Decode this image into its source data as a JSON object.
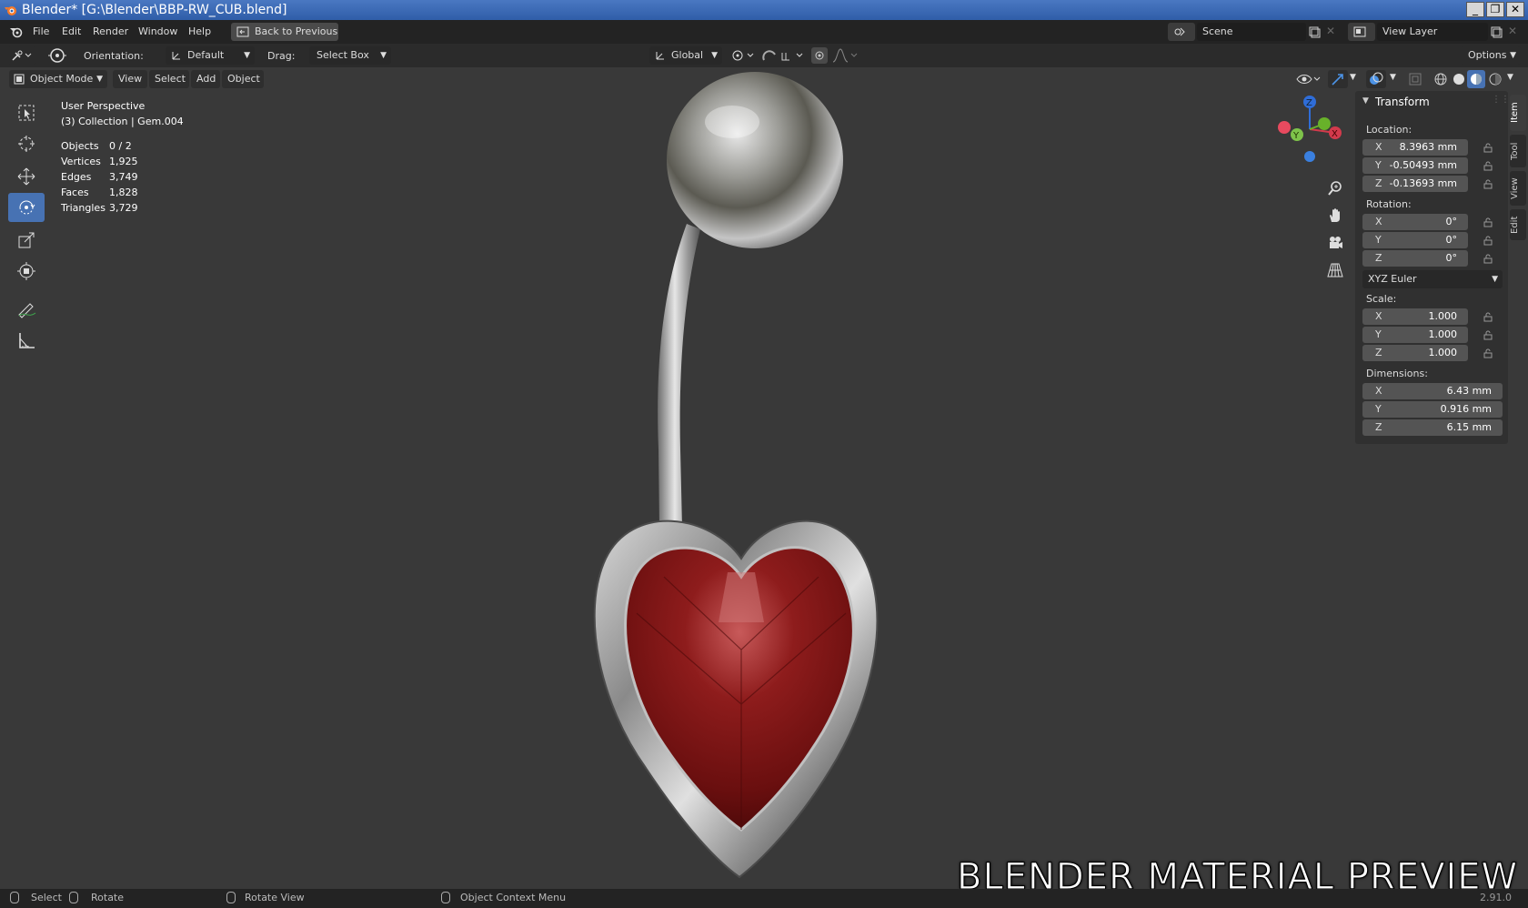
{
  "window": {
    "title": "Blender* [G:\\Blender\\BBP-RW_CUB.blend]",
    "controls": [
      "_",
      "❐",
      "✕"
    ]
  },
  "menubar": {
    "items": [
      "File",
      "Edit",
      "Render",
      "Window",
      "Help"
    ],
    "back_button": "Back to Previous",
    "scene_label": "Scene",
    "view_layer_label": "View Layer"
  },
  "tool_header": {
    "orientation_label": "Orientation:",
    "orientation_value": "Default",
    "drag_label": "Drag:",
    "drag_value": "Select Box",
    "transform_orientation": "Global",
    "options_label": "Options"
  },
  "view_header": {
    "mode": "Object Mode",
    "menus": [
      "View",
      "Select",
      "Add",
      "Object"
    ]
  },
  "viewport": {
    "perspective": "User Perspective",
    "collection": "(3) Collection | Gem.004",
    "stats": [
      {
        "label": "Objects",
        "value": "0 / 2"
      },
      {
        "label": "Vertices",
        "value": "1,925"
      },
      {
        "label": "Edges",
        "value": "3,749"
      },
      {
        "label": "Faces",
        "value": "1,828"
      },
      {
        "label": "Triangles",
        "value": "3,729"
      }
    ],
    "gizmo_axes": {
      "x": "X",
      "y": "Y",
      "z": "Z"
    },
    "overlay_text": "BLENDER MATERIAL PREVIEW"
  },
  "npanel": {
    "title": "Transform",
    "location_label": "Location:",
    "location": [
      {
        "axis": "X",
        "value": "8.3963 mm"
      },
      {
        "axis": "Y",
        "value": "-0.50493 mm"
      },
      {
        "axis": "Z",
        "value": "-0.13693 mm"
      }
    ],
    "rotation_label": "Rotation:",
    "rotation": [
      {
        "axis": "X",
        "value": "0°"
      },
      {
        "axis": "Y",
        "value": "0°"
      },
      {
        "axis": "Z",
        "value": "0°"
      }
    ],
    "rotation_mode": "XYZ Euler",
    "scale_label": "Scale:",
    "scale": [
      {
        "axis": "X",
        "value": "1.000"
      },
      {
        "axis": "Y",
        "value": "1.000"
      },
      {
        "axis": "Z",
        "value": "1.000"
      }
    ],
    "dimensions_label": "Dimensions:",
    "dimensions": [
      {
        "axis": "X",
        "value": "6.43 mm"
      },
      {
        "axis": "Y",
        "value": "0.916 mm"
      },
      {
        "axis": "Z",
        "value": "6.15 mm"
      }
    ],
    "side_tabs": [
      "Item",
      "Tool",
      "View",
      "Edit"
    ]
  },
  "statusbar": {
    "select": "Select",
    "rotate": "Rotate",
    "rotate_view": "Rotate View",
    "context_menu": "Object Context Menu",
    "version": "2.91.0"
  },
  "colors": {
    "accent": "#4772b3",
    "viewport_bg": "#393939",
    "gem": "#7a1212",
    "metal": "#b9b9b9"
  }
}
